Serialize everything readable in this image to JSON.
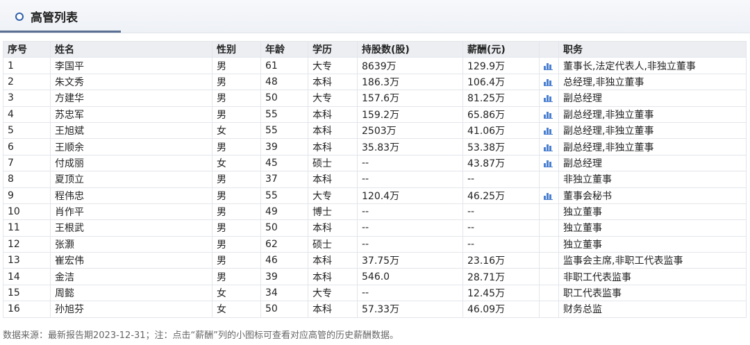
{
  "panel": {
    "title": "高管列表"
  },
  "table": {
    "headers": [
      "序号",
      "姓名",
      "性别",
      "年龄",
      "学历",
      "持股数(股)",
      "薪酬(元)",
      "",
      "职务"
    ],
    "rows": [
      {
        "no": "1",
        "name": "李国平",
        "gender": "男",
        "age": "61",
        "edu": "大专",
        "shares": "8639万",
        "salary": "129.9万",
        "has_chart": true,
        "position": "董事长,法定代表人,非独立董事"
      },
      {
        "no": "2",
        "name": "朱文秀",
        "gender": "男",
        "age": "48",
        "edu": "本科",
        "shares": "186.3万",
        "salary": "106.4万",
        "has_chart": true,
        "position": "总经理,非独立董事"
      },
      {
        "no": "3",
        "name": "方建华",
        "gender": "男",
        "age": "50",
        "edu": "大专",
        "shares": "157.6万",
        "salary": "81.25万",
        "has_chart": true,
        "position": "副总经理"
      },
      {
        "no": "4",
        "name": "苏忠军",
        "gender": "男",
        "age": "55",
        "edu": "本科",
        "shares": "159.2万",
        "salary": "65.86万",
        "has_chart": true,
        "position": "副总经理,非独立董事"
      },
      {
        "no": "5",
        "name": "王旭斌",
        "gender": "女",
        "age": "55",
        "edu": "本科",
        "shares": "2503万",
        "salary": "41.06万",
        "has_chart": true,
        "position": "副总经理,非独立董事"
      },
      {
        "no": "6",
        "name": "王顺余",
        "gender": "男",
        "age": "39",
        "edu": "本科",
        "shares": "35.83万",
        "salary": "53.38万",
        "has_chart": true,
        "position": "副总经理,非独立董事"
      },
      {
        "no": "7",
        "name": "付成丽",
        "gender": "女",
        "age": "45",
        "edu": "硕士",
        "shares": "--",
        "salary": "43.87万",
        "has_chart": true,
        "position": "副总经理"
      },
      {
        "no": "8",
        "name": "夏顶立",
        "gender": "男",
        "age": "37",
        "edu": "本科",
        "shares": "--",
        "salary": "--",
        "has_chart": false,
        "position": "非独立董事"
      },
      {
        "no": "9",
        "name": "程伟忠",
        "gender": "男",
        "age": "55",
        "edu": "大专",
        "shares": "120.4万",
        "salary": "46.25万",
        "has_chart": true,
        "position": "董事会秘书"
      },
      {
        "no": "10",
        "name": "肖作平",
        "gender": "男",
        "age": "49",
        "edu": "博士",
        "shares": "--",
        "salary": "--",
        "has_chart": false,
        "position": "独立董事"
      },
      {
        "no": "11",
        "name": "王根武",
        "gender": "男",
        "age": "50",
        "edu": "本科",
        "shares": "--",
        "salary": "--",
        "has_chart": false,
        "position": "独立董事"
      },
      {
        "no": "12",
        "name": "张灏",
        "gender": "男",
        "age": "62",
        "edu": "硕士",
        "shares": "--",
        "salary": "--",
        "has_chart": false,
        "position": "独立董事"
      },
      {
        "no": "13",
        "name": "崔宏伟",
        "gender": "男",
        "age": "46",
        "edu": "本科",
        "shares": "37.75万",
        "salary": "23.16万",
        "has_chart": false,
        "position": "监事会主席,非职工代表监事"
      },
      {
        "no": "14",
        "name": "金洁",
        "gender": "男",
        "age": "39",
        "edu": "本科",
        "shares": "546.0",
        "salary": "28.71万",
        "has_chart": false,
        "position": "非职工代表监事"
      },
      {
        "no": "15",
        "name": "周懿",
        "gender": "女",
        "age": "34",
        "edu": "大专",
        "shares": "--",
        "salary": "12.45万",
        "has_chart": false,
        "position": "职工代表监事"
      },
      {
        "no": "16",
        "name": "孙旭芬",
        "gender": "女",
        "age": "50",
        "edu": "本科",
        "shares": "57.33万",
        "salary": "46.09万",
        "has_chart": false,
        "position": "财务总监"
      }
    ]
  },
  "footnote": "数据来源：最新报告期2023-12-31；注：点击“薪酬”列的小图标可查看对应高管的历史薪酬数据。",
  "colors": {
    "accent": "#2f5fa8",
    "icon": "#4a7fd0",
    "header_bg": "#eceef2",
    "border": "#e2e5ea"
  },
  "icons": {
    "row_chart": "bar-chart-icon",
    "panel_bullet": "circle-bullet-icon"
  }
}
